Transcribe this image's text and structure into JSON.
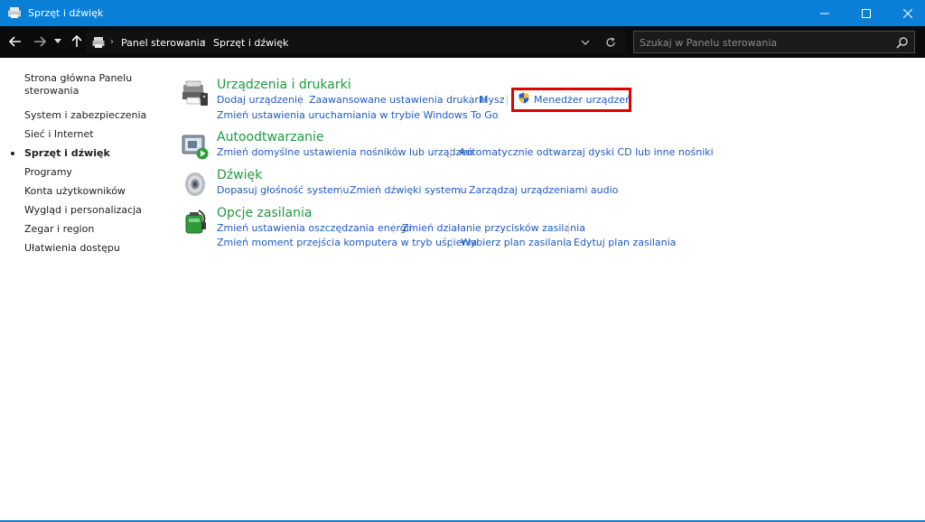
{
  "window": {
    "title": "Sprzęt i dźwięk",
    "controls": {
      "minimize": "—",
      "maximize": "☐",
      "close": "✕"
    }
  },
  "address_bar": {
    "back": "←",
    "forward": "→",
    "recent": "⌄",
    "up": "↑",
    "breadcrumbs": [
      "Panel sterowania",
      "Sprzęt i dźwięk"
    ],
    "separator": "›",
    "dropdown": "⌄",
    "refresh": "↻",
    "search_placeholder": "Szukaj w Panelu sterowania"
  },
  "sidebar": {
    "items": [
      {
        "label": "Strona główna Panelu sterowania"
      },
      {
        "label": "System i zabezpieczenia"
      },
      {
        "label": "Sieć i Internet"
      },
      {
        "label": "Sprzęt i dźwięk",
        "active": true
      },
      {
        "label": "Programy"
      },
      {
        "label": "Konta użytkowników"
      },
      {
        "label": "Wygląd i personalizacja"
      },
      {
        "label": "Zegar i region"
      },
      {
        "label": "Ułatwienia dostępu"
      }
    ]
  },
  "categories": [
    {
      "heading": "Urządzenia i drukarki",
      "icon": "printer-device-icon",
      "links_row1": [
        "Dodaj urządzenie",
        "Zaawansowane ustawienia drukarki",
        "Mysz",
        "Menedżer urządzeń"
      ],
      "links_row2": [
        "Zmień ustawienia uruchamiania w trybie Windows To Go"
      ]
    },
    {
      "heading": "Autoodtwarzanie",
      "icon": "autoplay-icon",
      "links_row1": [
        "Zmień domyślne ustawienia nośników lub urządzeń",
        "Automatycznie odtwarzaj dyski CD lub inne nośniki"
      ]
    },
    {
      "heading": "Dźwięk",
      "icon": "speaker-icon",
      "links_row1": [
        "Dopasuj głośność systemu",
        "Zmień dźwięki systemu",
        "Zarządzaj urządzeniami audio"
      ]
    },
    {
      "heading": "Opcje zasilania",
      "icon": "battery-power-icon",
      "links_row1": [
        "Zmień ustawienia oszczędzania energii",
        "Zmień działanie przycisków zasilania"
      ],
      "links_row2": [
        "Zmień moment przejścia komputera w tryb uśpienia",
        "Wybierz plan zasilania",
        "Edytuj plan zasilania"
      ]
    }
  ],
  "colors": {
    "titlebar": "#0a7fd8",
    "heading_green": "#1a9c3d",
    "link_blue": "#1c5ac7",
    "highlight_red": "#e00000"
  }
}
